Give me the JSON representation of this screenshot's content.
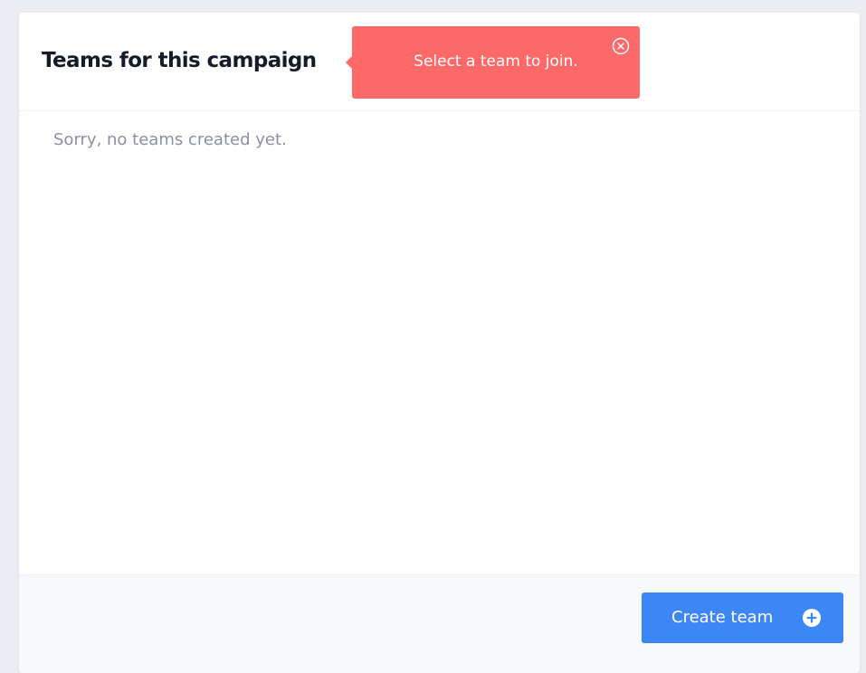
{
  "panel": {
    "title": "Teams for this campaign",
    "empty_message": "Sorry, no teams created yet."
  },
  "tooltip": {
    "message": "Select a team to join.",
    "close_icon": "close-circle-icon",
    "color": "#fd6868"
  },
  "footer": {
    "create_button_label": "Create team",
    "create_button_icon": "plus-circle-icon",
    "button_color": "#3d86f6"
  }
}
